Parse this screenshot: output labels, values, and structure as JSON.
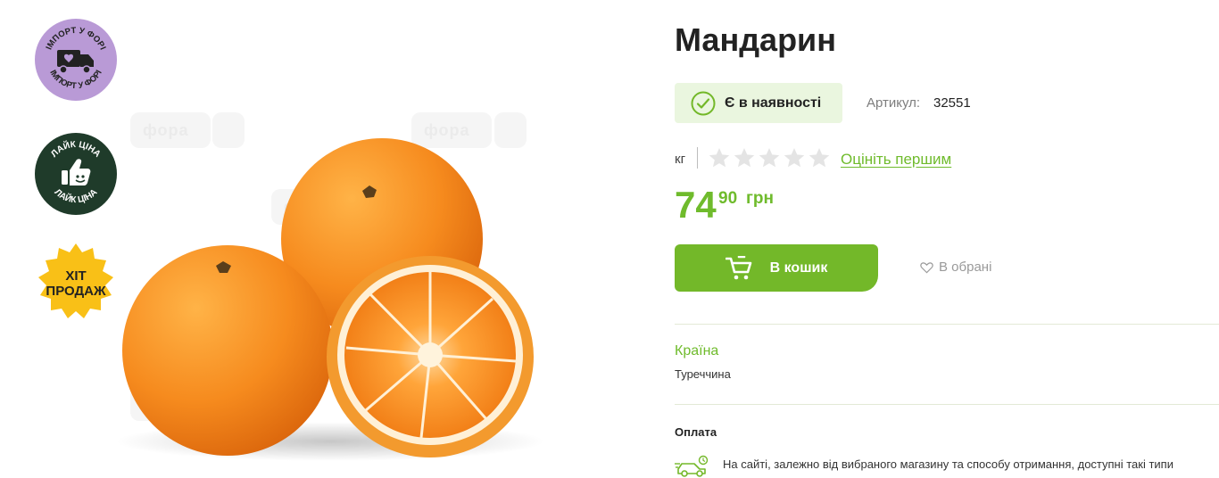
{
  "badges": {
    "import": {
      "text": "ІМПОРТ У ФОРІ",
      "color": "#b99ad6",
      "icon": "truck-icon"
    },
    "like_price": {
      "text": "ЛАЙК ЦІНА",
      "color": "#1f3b2a",
      "icon": "thumbs-up-icon"
    },
    "hit": {
      "line1": "ХІТ",
      "line2": "ПРОДАЖ",
      "color": "#f9c017",
      "icon": "star-burst-icon"
    }
  },
  "watermark": {
    "text": "фора"
  },
  "product": {
    "title": "Мандарин",
    "stock_status": "Є в наявності",
    "sku_label": "Артикул:",
    "sku": "32551",
    "unit": "кг",
    "rating_stars": 0,
    "rating_max": 5,
    "rate_link": "Оцініть першим",
    "price_int": "74",
    "price_frac": "90",
    "currency": "грн",
    "add_to_cart": "В кошик",
    "favorite": "В обрані"
  },
  "attributes": {
    "country_label": "Країна",
    "country_value": "Туреччина"
  },
  "payment": {
    "title": "Оплата",
    "text": "На сайті, залежно від вибраного магазину та способу отримання, доступні такі типи",
    "icon": "car-delivery-icon"
  },
  "colors": {
    "accent": "#73b829",
    "stock_bg": "#eaf6df"
  }
}
